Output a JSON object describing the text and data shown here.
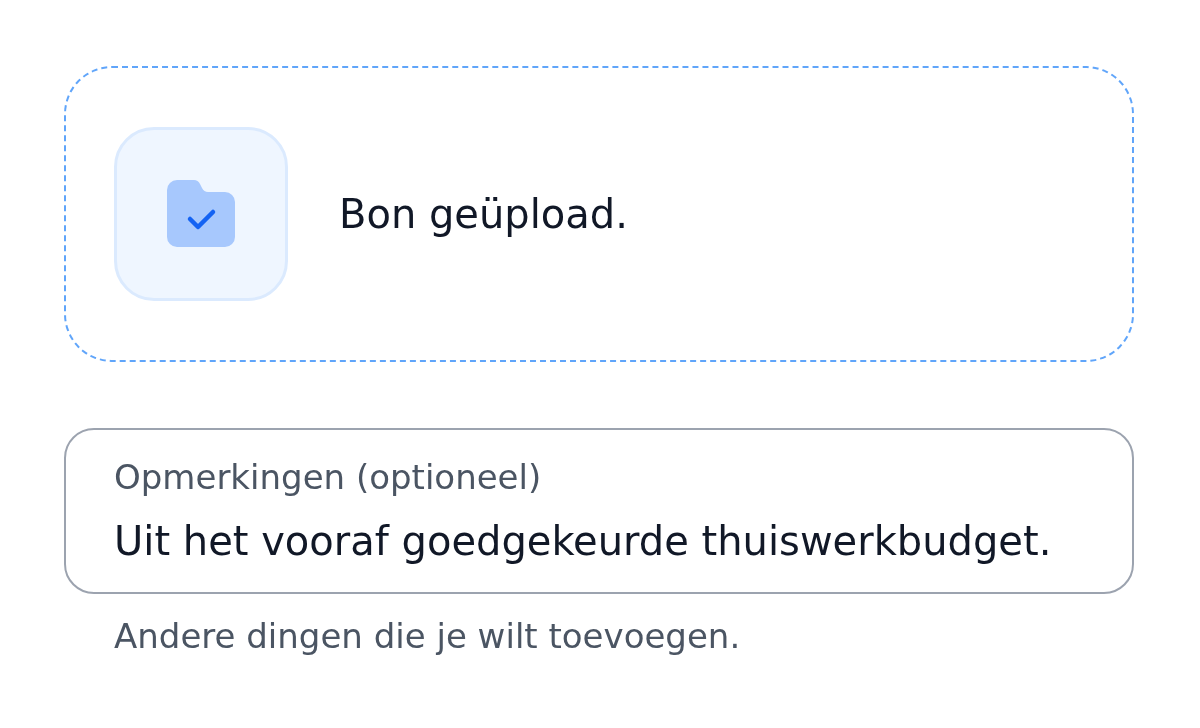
{
  "upload": {
    "message": "Bon geüpload."
  },
  "notes_field": {
    "label": "Opmerkingen (optioneel)",
    "value": "Uit het vooraf goedgekeurde thuiswerkbudget.",
    "helper": "Andere dingen die je wilt toevoegen."
  }
}
